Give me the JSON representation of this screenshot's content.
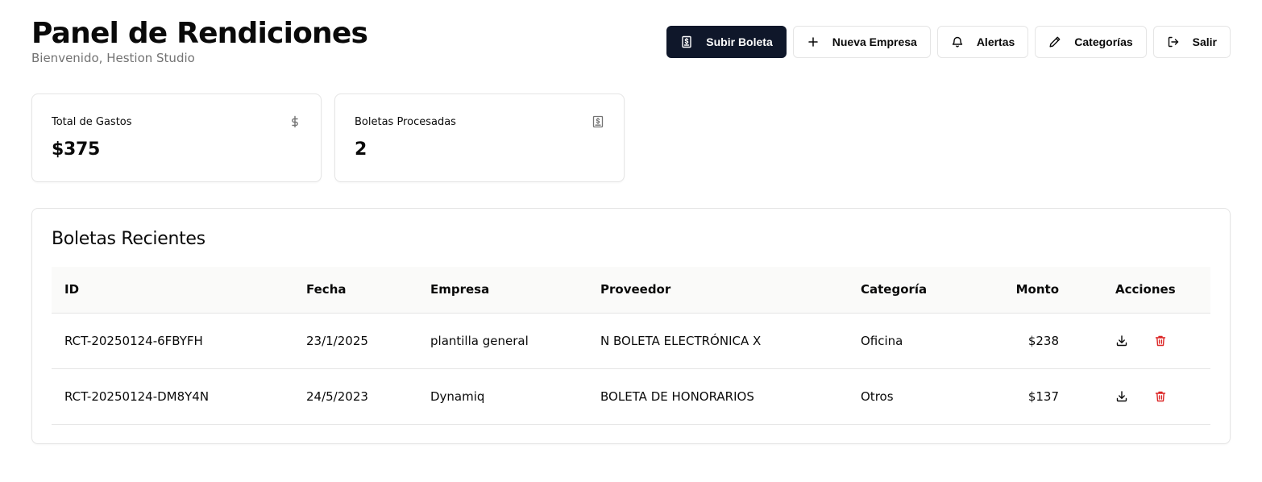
{
  "header": {
    "title": "Panel de Rendiciones",
    "subtitle": "Bienvenido, Hestion Studio"
  },
  "toolbar": {
    "upload_label": "Subir Boleta",
    "new_company_label": "Nueva Empresa",
    "alerts_label": "Alertas",
    "categories_label": "Categorías",
    "logout_label": "Salir"
  },
  "stats": {
    "total": {
      "label": "Total de Gastos",
      "value": "$375",
      "icon": "dollar-icon"
    },
    "processed": {
      "label": "Boletas Procesadas",
      "value": "2",
      "icon": "receipt-icon"
    }
  },
  "recent": {
    "title": "Boletas Recientes",
    "columns": {
      "id": "ID",
      "fecha": "Fecha",
      "empresa": "Empresa",
      "proveedor": "Proveedor",
      "categoria": "Categoría",
      "monto": "Monto",
      "acciones": "Acciones"
    },
    "rows": [
      {
        "id": "RCT-20250124-6FBYFH",
        "fecha": "23/1/2025",
        "empresa": "plantilla general",
        "proveedor": "N BOLETA ELECTRÓNICA X",
        "categoria": "Oficina",
        "monto": "$238"
      },
      {
        "id": "RCT-20250124-DM8Y4N",
        "fecha": "24/5/2023",
        "empresa": "Dynamiq",
        "proveedor": "BOLETA DE HONORARIOS",
        "categoria": "Otros",
        "monto": "$137"
      }
    ]
  },
  "colors": {
    "primary": "#0f172a",
    "delete": "#dc2626",
    "muted": "#737373",
    "border": "#e5e5e5"
  }
}
